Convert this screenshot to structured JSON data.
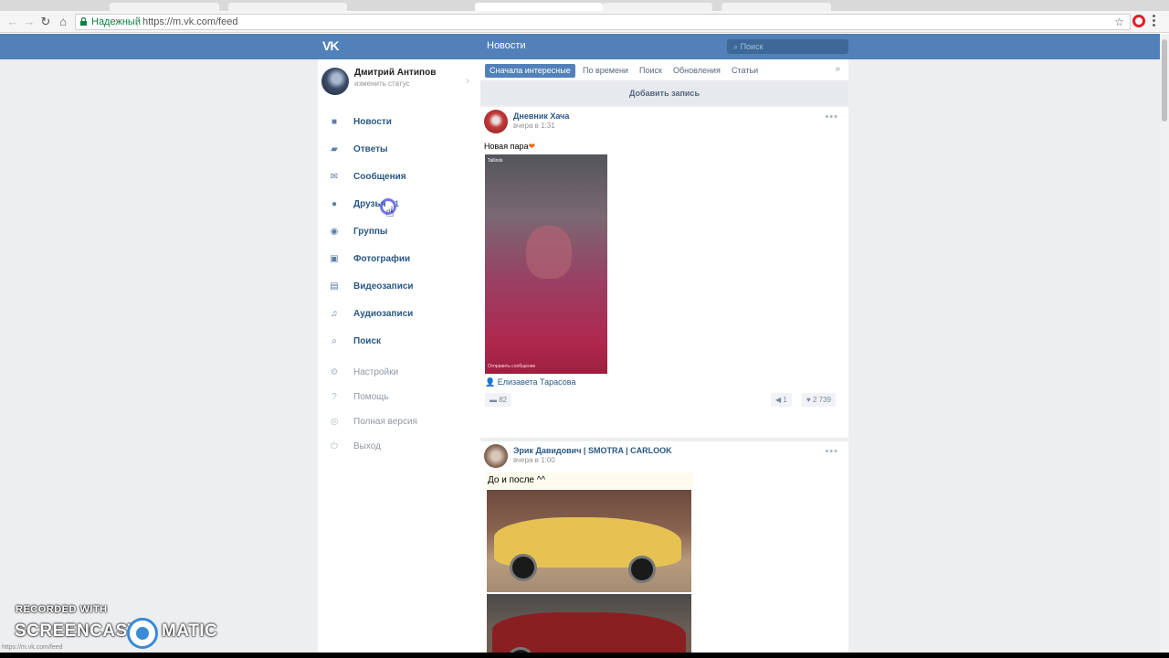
{
  "browser": {
    "secure_label": "Надежный",
    "url": "https://m.vk.com/feed",
    "status_url": "https://m.vk.com/feed"
  },
  "header": {
    "logo": "VK",
    "title": "Новости",
    "search_placeholder": "Поиск"
  },
  "profile": {
    "name": "Дмитрий Антипов",
    "status": "изменить статус"
  },
  "menu": {
    "main": [
      {
        "label": "Новости",
        "icon": "news-icon"
      },
      {
        "label": "Ответы",
        "icon": "replies-icon"
      },
      {
        "label": "Сообщения",
        "icon": "messages-icon"
      },
      {
        "label": "Друзья",
        "icon": "friends-icon",
        "badge": "1"
      },
      {
        "label": "Группы",
        "icon": "groups-icon"
      },
      {
        "label": "Фотографии",
        "icon": "photos-icon"
      },
      {
        "label": "Видеозаписи",
        "icon": "videos-icon"
      },
      {
        "label": "Аудиозаписи",
        "icon": "audio-icon"
      },
      {
        "label": "Поиск",
        "icon": "search-icon"
      }
    ],
    "secondary": [
      {
        "label": "Настройки",
        "icon": "gear-icon"
      },
      {
        "label": "Помощь",
        "icon": "help-icon"
      },
      {
        "label": "Полная версия",
        "icon": "globe-icon"
      },
      {
        "label": "Выход",
        "icon": "power-icon"
      }
    ]
  },
  "feed": {
    "tabs": [
      "Сначала интересные",
      "По времени",
      "Поиск",
      "Обновления",
      "Статьи"
    ],
    "active_tab": "Сначала интересные",
    "add_post": "Добавить запись",
    "posts": [
      {
        "author": "Дневник Хача",
        "time": "вчера в 1:31",
        "text": "Новая пара",
        "emoji": "❤",
        "photo_top_label": "Tallinok",
        "photo_bottom_label": "Отправить сообщение",
        "tagged": "Елизавета Тарасова",
        "comments": "82",
        "reposts": "1",
        "likes": "2 739"
      },
      {
        "author": "Эрик Давидович | SMOTRA | CARLOOK",
        "time": "вчера в 1:00",
        "text": "До и после ^^"
      }
    ]
  },
  "watermark": {
    "line1": "RECORDED WITH",
    "line2a": "SCREENCAST",
    "line2b": "MATIC"
  }
}
